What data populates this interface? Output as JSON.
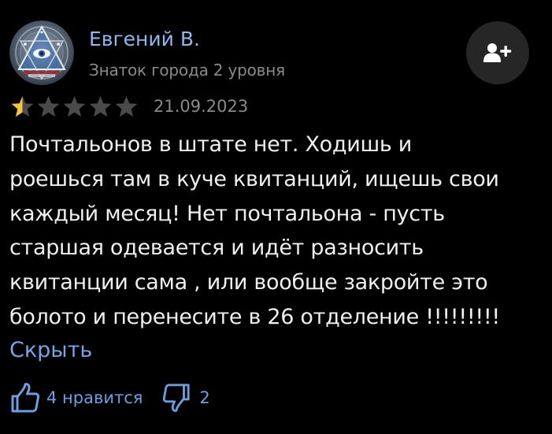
{
  "author": {
    "name": "Евгений В.",
    "level": "Знаток города 2 уровня",
    "avatar_icon": "eye-triangle-avatar"
  },
  "subscribe_button": {
    "icon": "add-user-icon"
  },
  "rating": {
    "value": 1,
    "max": 5,
    "filled_color": "#f6c343",
    "empty_color": "#4a4a4a"
  },
  "review": {
    "date": "21.09.2023",
    "lines": [
      "Почтальонов в штате нет. Ходишь и",
      "роешься там в куче квитанций, ищешь свои",
      "каждый месяц! Нет почтальона - пусть",
      "старшая одевается и идёт разносить",
      "квитанции сама , или вообще закройте это",
      "болото и перенесите в 26 отделение !!!!!!!!!"
    ],
    "collapse_label": "Скрыть"
  },
  "reactions": {
    "like_label": "4 нравится",
    "like_icon": "thumbs-up-icon",
    "dislike_label": "2",
    "dislike_icon": "thumbs-down-icon"
  },
  "colors": {
    "background": "#000000",
    "name": "#8fb6ee",
    "link": "#77a4e6",
    "muted": "#8a8a8a",
    "text": "#f0f0f0"
  }
}
